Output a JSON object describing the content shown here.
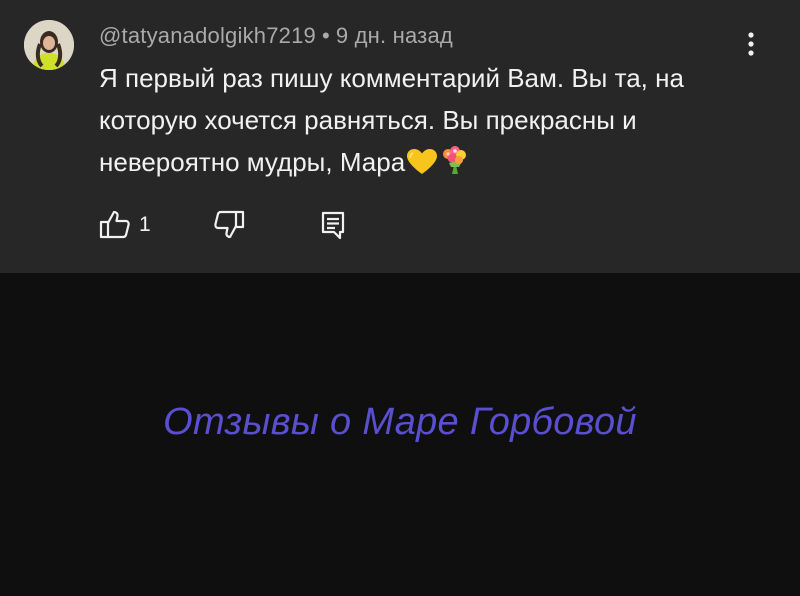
{
  "comment": {
    "author": "@tatyanadolgikh7219",
    "separator": "•",
    "time": "9 дн. назад",
    "text": "Я первый раз пишу комментарий Вам. Вы та, на которую хочется равняться. Вы прекрасны и невероятно мудры, Мара",
    "emojis": [
      "yellow-heart-icon",
      "bouquet-icon"
    ],
    "likes": "1",
    "actions": [
      "like-icon",
      "dislike-icon",
      "reply-icon"
    ],
    "menu_icon": "more-vert-icon"
  },
  "video": {
    "title": "Отзывы о Маре Горбовой",
    "title_color": "#5a4fd0"
  },
  "colors": {
    "panel_bg": "#272727",
    "page_bg": "#0f0f0f",
    "text_primary": "#f1f1f1",
    "text_secondary": "#aaaaaa"
  }
}
